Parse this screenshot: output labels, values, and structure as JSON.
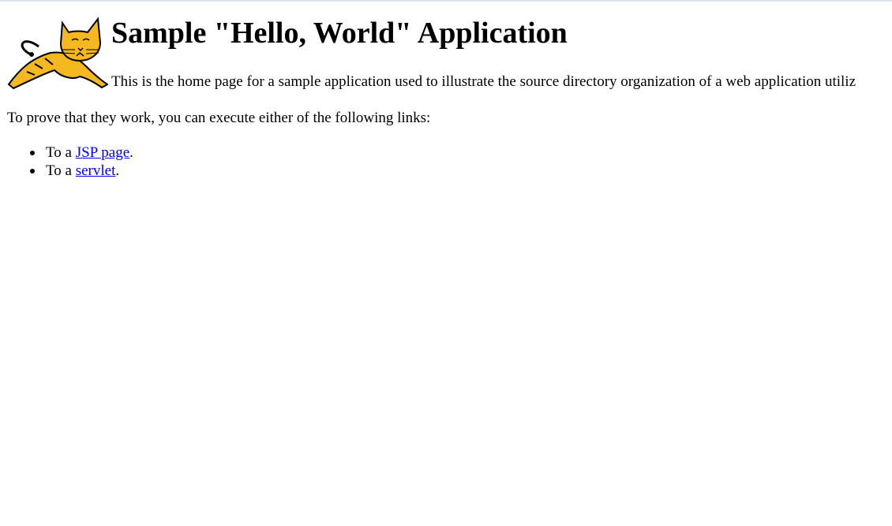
{
  "header": {
    "logo_icon": "tomcat-logo-icon",
    "title": "Sample \"Hello, World\" Application"
  },
  "intro": {
    "text": "This is the home page for a sample application used to illustrate the source directory organization of a web application utiliz"
  },
  "prove": {
    "text": "To prove that they work, you can execute either of the following links:"
  },
  "links": [
    {
      "prefix": "To a ",
      "link_text": "JSP page",
      "suffix": "."
    },
    {
      "prefix": "To a ",
      "link_text": "servlet",
      "suffix": "."
    }
  ],
  "colors": {
    "link": "#0000ee",
    "text": "#000000",
    "logo_fill": "#f5b81e",
    "top_border": "#dfe4ea"
  }
}
